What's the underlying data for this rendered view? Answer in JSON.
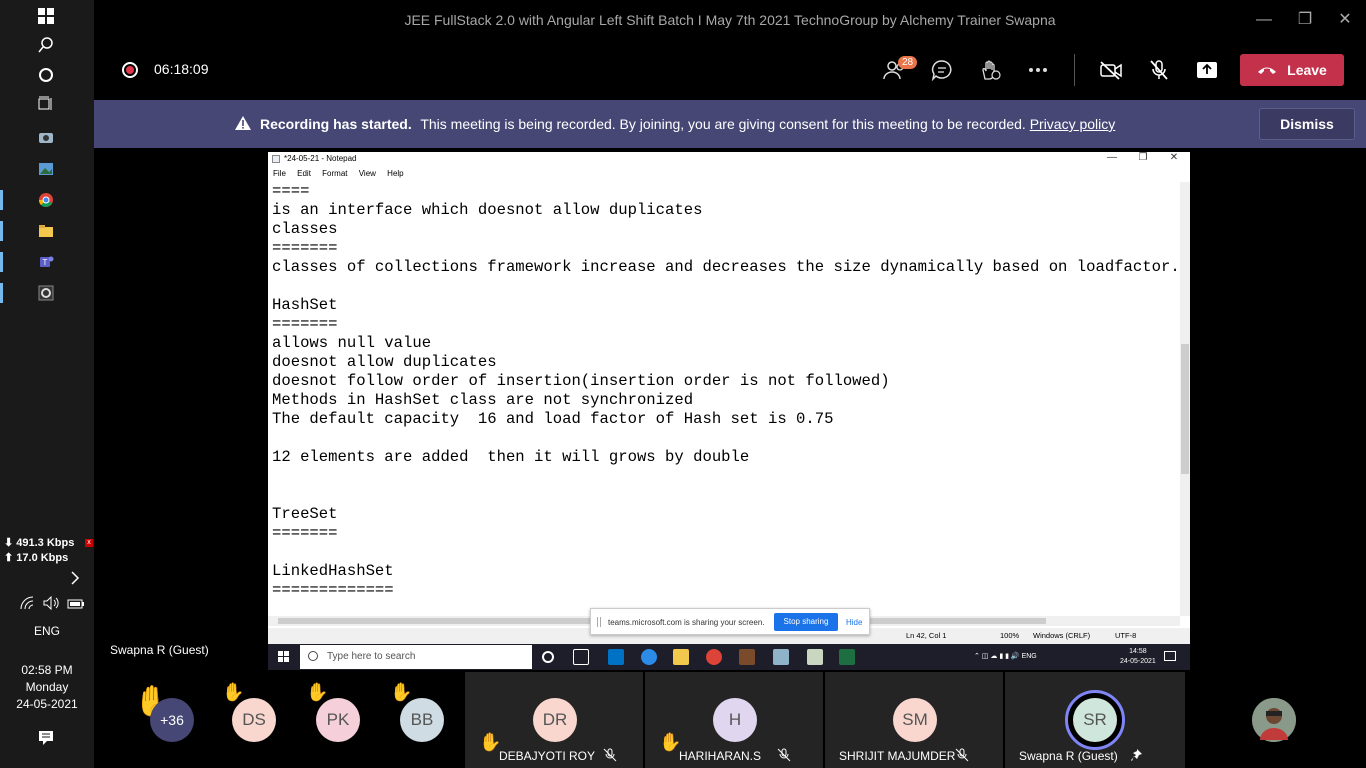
{
  "window": {
    "title": "JEE FullStack 2.0 with Angular Left Shift Batch I May 7th 2021 TechnoGroup by Alchemy Trainer Swapna"
  },
  "call": {
    "timer": "06:18:09",
    "people_count": "28",
    "leave_label": "Leave"
  },
  "banner": {
    "bold": "Recording has started.",
    "message": "This meeting is being recorded. By joining, you are giving consent for this meeting to be recorded.",
    "link": "Privacy policy",
    "dismiss_label": "Dismiss"
  },
  "taskbar": {
    "download": "⬇ 491.3 Kbps",
    "upload": "⬆ 17.0 Kbps",
    "language": "ENG",
    "time": "02:58 PM",
    "day": "Monday",
    "date": "24-05-2021"
  },
  "notepad": {
    "title": "*24-05-21 - Notepad",
    "menu": [
      "File",
      "Edit",
      "Format",
      "View",
      "Help"
    ],
    "content": "====\nis an interface which doesnot allow duplicates\nclasses\n=======\nclasses of collections framework increase and decreases the size dynamically based on loadfactor.\n\nHashSet\n=======\nallows null value\ndoesnot allow duplicates\ndoesnot follow order of insertion(insertion order is not followed)\nMethods in HashSet class are not synchronized\nThe default capacity  16 and load factor of Hash set is 0.75\n\n12 elements are added  then it will grows by double\n\n\nTreeSet\n=======\n\nLinkedHashSet\n=============",
    "status": {
      "position": "Ln 42, Col 1",
      "zoom": "100%",
      "line_ending": "Windows (CRLF)",
      "encoding": "UTF-8"
    }
  },
  "sharing": {
    "message": "teams.microsoft.com is sharing your screen.",
    "stop_label": "Stop sharing",
    "hide_label": "Hide"
  },
  "remote_taskbar": {
    "search_placeholder": "Type here to search",
    "language": "ENG",
    "time": "14:58",
    "date": "24-05-2021"
  },
  "presenter": "Swapna R (Guest)",
  "participants": {
    "overflow": "+36",
    "avatars": [
      {
        "initials": "DS",
        "color": "#f9d7cf"
      },
      {
        "initials": "PK",
        "color": "#f5cfd9"
      },
      {
        "initials": "BB",
        "color": "#cfdce3"
      }
    ],
    "tiles": [
      {
        "initials": "DR",
        "name": "DEBAJYOTI ROY",
        "color": "#f9d7cf"
      },
      {
        "initials": "H",
        "name": "HARIHARAN.S",
        "color": "#e0d6f0"
      },
      {
        "initials": "SM",
        "name": "SHRIJIT MAJUMDER",
        "color": "#f9d7cf"
      },
      {
        "initials": "SR",
        "name": "Swapna R (Guest)",
        "color": "#cfe6dc"
      }
    ]
  }
}
